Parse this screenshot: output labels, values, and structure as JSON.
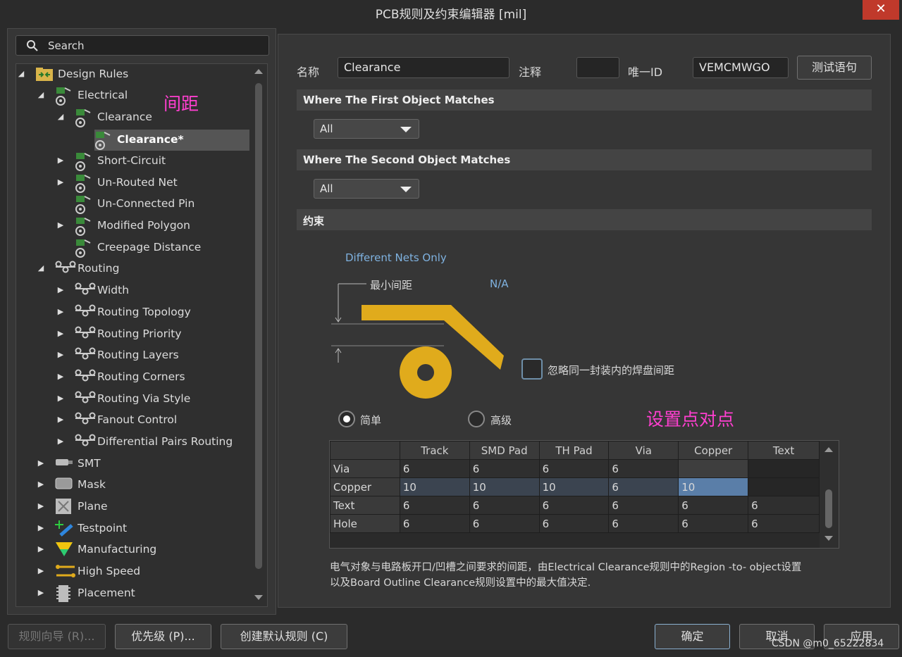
{
  "window": {
    "title": "PCB规则及约束编辑器 [mil]",
    "close_glyph": "✕"
  },
  "search": {
    "placeholder": "Search"
  },
  "tree": {
    "root": "Design Rules",
    "electrical": "Electrical",
    "clearance_group": "Clearance",
    "clearance_rule": "Clearance*",
    "short_circuit": "Short-Circuit",
    "unrouted_net": "Un-Routed Net",
    "unconnected_pin": "Un-Connected Pin",
    "modified_polygon": "Modified Polygon",
    "creepage": "Creepage Distance",
    "routing": "Routing",
    "width": "Width",
    "routing_topology": "Routing Topology",
    "routing_priority": "Routing Priority",
    "routing_layers": "Routing Layers",
    "routing_corners": "Routing Corners",
    "routing_via_style": "Routing Via Style",
    "fanout_control": "Fanout Control",
    "diff_pairs": "Differential Pairs Routing",
    "smt": "SMT",
    "mask": "Mask",
    "plane": "Plane",
    "testpoint": "Testpoint",
    "manufacturing": "Manufacturing",
    "high_speed": "High Speed",
    "placement": "Placement"
  },
  "annotations": {
    "spacing": "间距",
    "point_to_point": "设置点对点"
  },
  "form": {
    "name_label": "名称",
    "name_value": "Clearance",
    "comment_label": "注释",
    "comment_value": "",
    "uid_label": "唯一ID",
    "uid_value": "VEMCMWGO",
    "test_button": "测试语句"
  },
  "first_match": {
    "title": "Where The First Object Matches",
    "value": "All"
  },
  "second_match": {
    "title": "Where The Second Object Matches",
    "value": "All"
  },
  "constraints": {
    "title": "约束",
    "different_nets": "Different Nets Only",
    "min_clearance_label": "最小间距",
    "min_clearance_value": "N/A",
    "ignore_pads_label": "忽略同一封装内的焊盘间距",
    "ignore_pads_checked": false,
    "mode_simple": "简单",
    "mode_advanced": "高级",
    "selected_mode": "简单",
    "shape_color": "#e0ab1c"
  },
  "table": {
    "columns": [
      "",
      "Track",
      "SMD Pad",
      "TH Pad",
      "Via",
      "Copper",
      "Text"
    ],
    "rows": [
      [
        "Via",
        "6",
        "6",
        "6",
        "6",
        "",
        ""
      ],
      [
        "Copper",
        "10",
        "10",
        "10",
        "6",
        "10",
        ""
      ],
      [
        "Text",
        "6",
        "6",
        "6",
        "6",
        "6",
        "6"
      ],
      [
        "Hole",
        "6",
        "6",
        "6",
        "6",
        "6",
        "6"
      ]
    ]
  },
  "description": {
    "line1": "电气对象与电路板开口/凹槽之间要求的间距，由Electrical Clearance规则中的Region -to- object设置",
    "line2": "以及Board Outline Clearance规则设置中的最大值决定."
  },
  "buttons": {
    "wizard": "规则向导 (R)...",
    "priority": "优先级 (P)...",
    "create_default": "创建默认规则 (C)",
    "ok": "确定",
    "cancel": "取消",
    "apply": "应用"
  },
  "watermark": "CSDN @m0_65222834"
}
